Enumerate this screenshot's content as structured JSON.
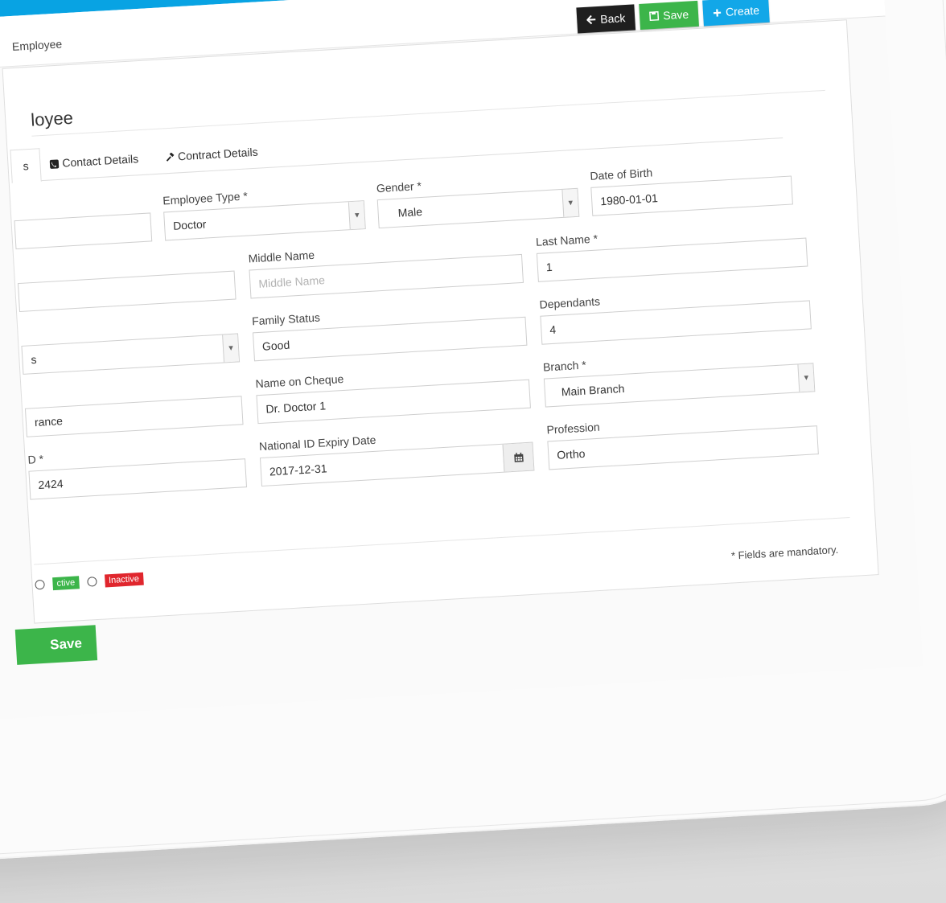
{
  "breadcrumb": "Employee",
  "header": {
    "back_label": "Back",
    "save_label": "Save",
    "create_label": "Create"
  },
  "page": {
    "title": "loyee"
  },
  "tabs": [
    {
      "label": "s",
      "icon": "none",
      "active": true
    },
    {
      "label": "Contact Details",
      "icon": "phone-icon",
      "active": false
    },
    {
      "label": "Contract Details",
      "icon": "gavel-icon",
      "active": false
    }
  ],
  "fields": {
    "employee_type": {
      "label": "Employee Type *",
      "value": "Doctor"
    },
    "gender": {
      "label": "Gender *",
      "value": "Male"
    },
    "date_of_birth": {
      "label": "Date of Birth",
      "value": "1980-01-01"
    },
    "middle_name": {
      "label": "Middle Name",
      "value": "",
      "placeholder": "Middle Name"
    },
    "last_name": {
      "label": "Last Name *",
      "value": "1"
    },
    "family_status": {
      "label": "Family Status",
      "value": "Good"
    },
    "dependants": {
      "label": "Dependants",
      "value": "4"
    },
    "status_select": {
      "value": "s"
    },
    "name_on_cheque": {
      "label": "Name on Cheque",
      "value": "Dr. Doctor 1"
    },
    "branch": {
      "label": "Branch *",
      "value": "Main Branch"
    },
    "insurance": {
      "value": "rance"
    },
    "national_id_expiry": {
      "label": "National ID Expiry Date",
      "value": "2017-12-31"
    },
    "profession": {
      "label": "Profession",
      "value": "Ortho"
    },
    "national_id": {
      "label": "D *",
      "value": "2424"
    }
  },
  "status": {
    "active_label": "ctive",
    "inactive_label": "Inactive"
  },
  "mandatory_note": "* Fields are mandatory.",
  "footer": {
    "save_label": "Save"
  },
  "colors": {
    "topbar": "#08a3e3",
    "success": "#3cb54a",
    "danger": "#e0262d",
    "info": "#12a7e8",
    "dark": "#1f1f1f"
  }
}
